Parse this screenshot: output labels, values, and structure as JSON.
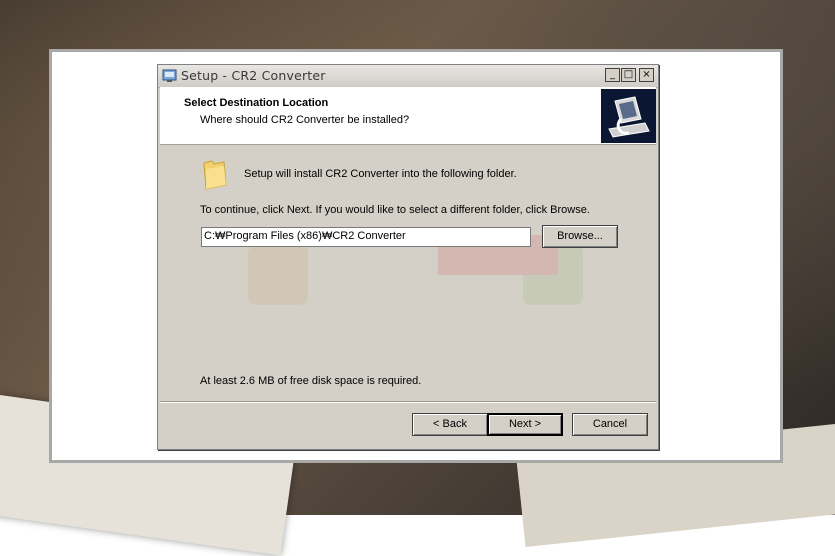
{
  "window": {
    "title": "Setup - CR2 Converter",
    "controls": {
      "minimize": "_",
      "maximize": "□",
      "close": "×"
    }
  },
  "header": {
    "title": "Select Destination Location",
    "subtitle": "Where should CR2 Converter be installed?"
  },
  "body": {
    "install_message": "Setup will install CR2 Converter into the following folder.",
    "continue_message": "To continue, click Next. If you would like to select a different folder, click Browse.",
    "path_value": "C:₩Program Files (x86)₩CR2 Converter",
    "browse_label": "Browse...",
    "disk_space_message": "At least 2.6 MB of free disk space is required."
  },
  "footer": {
    "back_label": "< Back",
    "next_label": "Next >",
    "cancel_label": "Cancel"
  },
  "icons": {
    "app": "setup-app-icon",
    "folder": "folder-icon",
    "header_image": "installer-computer-icon"
  },
  "colors": {
    "dialog_bg": "#d4d0c8",
    "header_image_bg": "#0b1633",
    "folder_yellow": "#f2d06b"
  }
}
